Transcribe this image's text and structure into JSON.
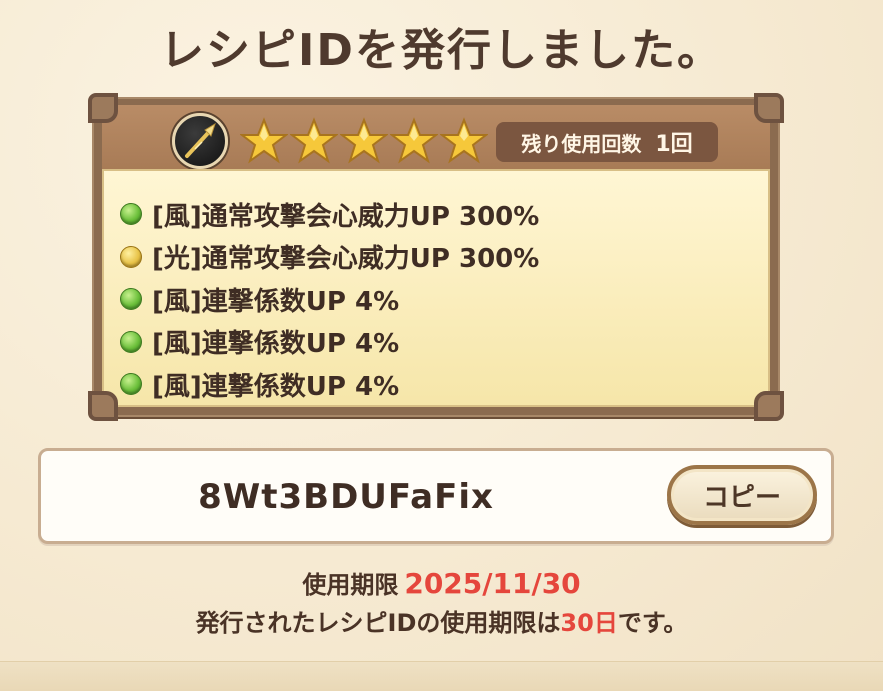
{
  "title": "レシピIDを発行しました。",
  "recipe": {
    "weapon_icon": "spear-icon",
    "stars": 5,
    "remaining_label": "残り使用回数",
    "remaining_count": "1回",
    "effects": [
      {
        "text": "[風]通常攻撃会心威力UP 300%",
        "color": "green"
      },
      {
        "text": "[光]通常攻撃会心威力UP 300%",
        "color": "gold"
      },
      {
        "text": "[風]連撃係数UP 4%",
        "color": "green"
      },
      {
        "text": "[風]連撃係数UP 4%",
        "color": "green"
      },
      {
        "text": "[風]連撃係数UP 4%",
        "color": "green"
      }
    ]
  },
  "recipe_id": "8Wt3BDUFaFix",
  "copy_label": "コピー",
  "expiry": {
    "label": "使用期限",
    "date": "2025/11/30"
  },
  "note": {
    "prefix": "発行されたレシピIDの使用期限は",
    "days": "30日",
    "suffix": "です。"
  },
  "colors": {
    "accent_red": "#e5463c",
    "wind_green": "#6bbf3a",
    "light_gold": "#e8c348"
  }
}
